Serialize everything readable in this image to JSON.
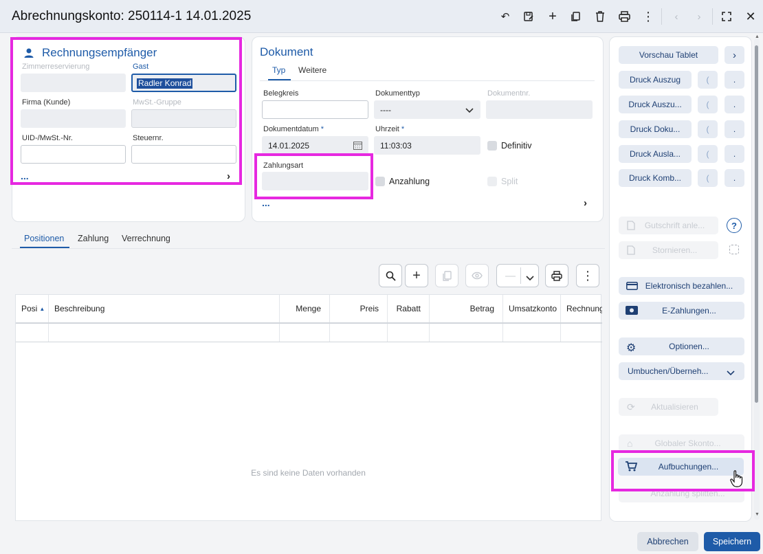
{
  "window": {
    "title": "Abrechnungskonto: 250114-1 14.01.2025"
  },
  "toolbar": {
    "icons": [
      "undo-icon",
      "save-edit-icon",
      "add-icon",
      "copy-icon",
      "delete-icon",
      "print-icon",
      "more-vert-icon",
      "prev-icon",
      "next-icon",
      "fullscreen-icon",
      "close-icon"
    ]
  },
  "recipient": {
    "title": "Rechnungsempfänger",
    "zimmer_label": "Zimmerreservierung",
    "gast_label": "Gast",
    "gast_value": "Radler Konrad",
    "firma_label": "Firma (Kunde)",
    "mwst_label": "MwSt.-Gruppe",
    "uid_label": "UID-/MwSt.-Nr.",
    "steuer_label": "Steuernr.",
    "more": "..."
  },
  "document": {
    "title": "Dokument",
    "tab_typ": "Typ",
    "tab_weitere": "Weitere",
    "belegkreis_label": "Belegkreis",
    "dokumenttyp_label": "Dokumenttyp",
    "dokumenttyp_value": "----",
    "dokumentnr_label": "Dokumentnr.",
    "datum_label": "Dokumentdatum",
    "datum_value": "14.01.2025",
    "uhrzeit_label": "Uhrzeit",
    "uhrzeit_value": "11:03:03",
    "required": "*",
    "definitiv": "Definitiv",
    "zahlungsart_label": "Zahlungsart",
    "anzahlung": "Anzahlung",
    "split": "Split",
    "more": "..."
  },
  "tabs": {
    "positionen": "Positionen",
    "zahlung": "Zahlung",
    "verrechnung": "Verrechnung"
  },
  "grid": {
    "columns": [
      "Posi",
      "Beschreibung",
      "Menge",
      "Preis",
      "Rabatt",
      "Betrag",
      "Umsatzkonto",
      "Rechnung"
    ],
    "empty": "Es sind keine Daten vorhanden",
    "dash": "—"
  },
  "sidebar": {
    "vorschau": "Vorschau Tablet",
    "druck": [
      "Druck Auszug",
      "Druck Auszu...",
      "Druck Doku...",
      "Druck Ausla...",
      "Druck Komb..."
    ],
    "dot": ".",
    "gutschrift": "Gutschrift anle...",
    "stornieren": "Stornieren...",
    "elektronisch": "Elektronisch bezahlen...",
    "ezahlungen": "E-Zahlungen...",
    "optionen": "Optionen...",
    "umbuchen": "Umbuchen/Überneh...",
    "aktualisieren": "Aktualisieren",
    "skonto": "Globaler Skonto...",
    "aufbuchungen": "Aufbuchungen...",
    "anzahlung_splitten": "Anzahlung splitten..."
  },
  "footer": {
    "cancel": "Abbrechen",
    "save": "Speichern"
  },
  "colors": {
    "accent": "#1e5ba8",
    "highlight": "#e628e0"
  }
}
